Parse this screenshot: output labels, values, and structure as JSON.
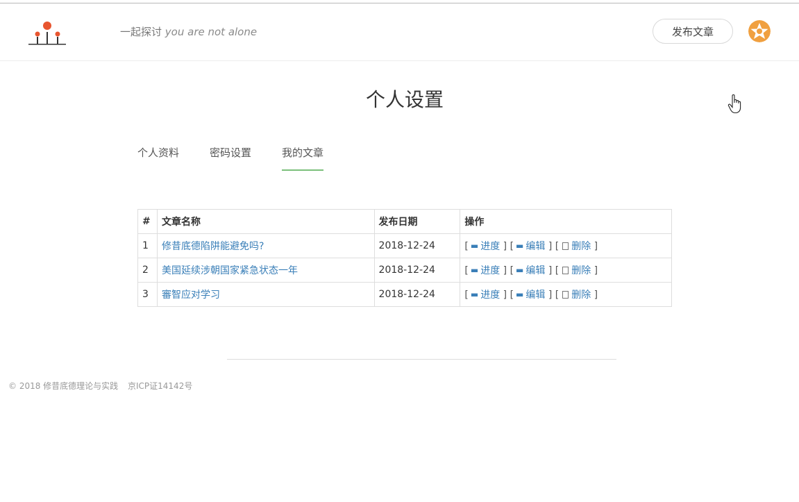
{
  "header": {
    "slogan_cn": "一起探讨",
    "slogan_en": "you are not alone",
    "publish_label": "发布文章",
    "logo_icon": "sun-people-logo-icon",
    "avatar_icon": "orange-star-avatar-icon"
  },
  "page_title": "个人设置",
  "tabs": [
    {
      "label": "个人资料",
      "active": false
    },
    {
      "label": "密码设置",
      "active": false
    },
    {
      "label": "我的文章",
      "active": true
    }
  ],
  "table": {
    "headers": [
      "#",
      "文章名称",
      "发布日期",
      "操作"
    ],
    "rows": [
      {
        "index": "1",
        "title": "修昔底德陷阱能避免吗?",
        "date": "2018-12-24"
      },
      {
        "index": "2",
        "title": "美国延续涉朝国家紧急状态一年",
        "date": "2018-12-24"
      },
      {
        "index": "3",
        "title": "審智应对学习",
        "date": "2018-12-24"
      }
    ],
    "actions": {
      "progress": "进度",
      "edit": "编辑",
      "delete": "删除"
    }
  },
  "footer": {
    "copyright": "© 2018 修昔底德理论与实践",
    "icp": "京ICP证14142号"
  },
  "colors": {
    "link": "#3a7fb8",
    "tab_active_underline": "#7bc07b",
    "logo_orange": "#e8552f",
    "avatar_orange": "#f0a040"
  }
}
